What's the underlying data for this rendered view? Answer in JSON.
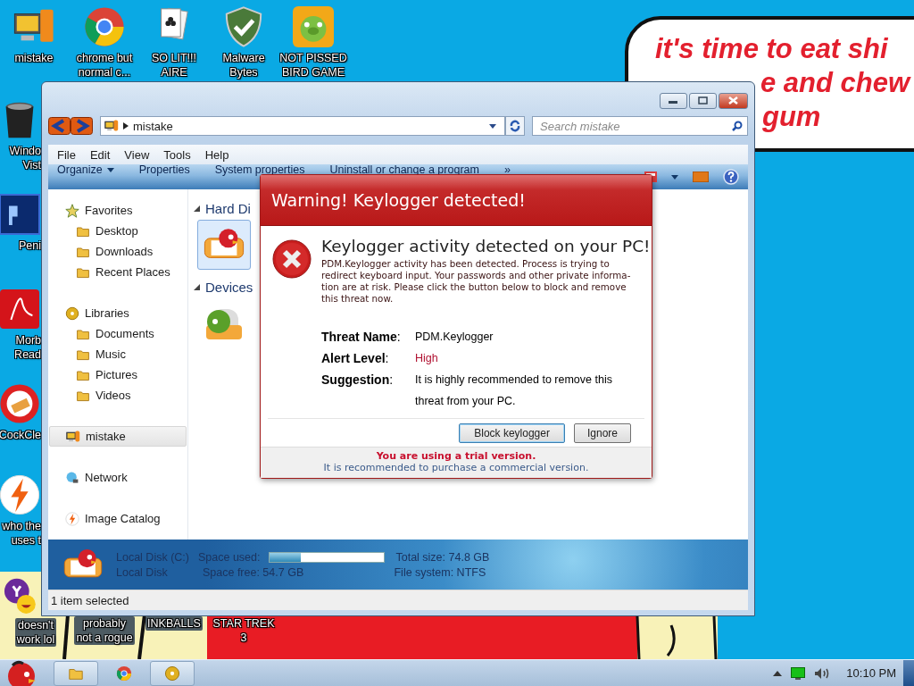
{
  "wallpaper": {
    "speech_bubble": [
      "it's time to eat shi",
      "e and chew",
      "gum"
    ]
  },
  "desktop_icons": [
    {
      "kind": "computer",
      "lines": [
        "mistake"
      ]
    },
    {
      "kind": "browser",
      "lines": [
        "chrome but",
        "normal c..."
      ]
    },
    {
      "kind": "cards",
      "lines": [
        "SO LIT!!!",
        "AIRE"
      ]
    },
    {
      "kind": "shield",
      "lines": [
        "Malware",
        "Bytes"
      ]
    },
    {
      "kind": "pig",
      "lines": [
        "NOT PISSED",
        "BIRD GAME"
      ]
    },
    {
      "kind": "bin",
      "lines": [
        "Windo",
        "Vist"
      ]
    },
    {
      "kind": "ps",
      "lines": [
        "Peni"
      ]
    },
    {
      "kind": "pdf",
      "lines": [
        "Morb",
        "Read"
      ]
    },
    {
      "kind": "cleaner",
      "lines": [
        "CockCle"
      ]
    },
    {
      "kind": "bolt",
      "lines": [
        "who the",
        "uses t"
      ]
    },
    {
      "kind": "yahoo",
      "lines": [
        "doesn't",
        "work lol"
      ]
    },
    {
      "kind": "hidden",
      "lines": [
        "probably",
        "not a rogue"
      ]
    },
    {
      "kind": "hidden",
      "lines": [
        "INKBALLS"
      ]
    },
    {
      "kind": "hidden",
      "lines": [
        "STAR TREK",
        "3"
      ]
    }
  ],
  "explorer": {
    "address": "mistake",
    "search": {
      "placeholder": "Search mistake"
    },
    "menu": [
      "File",
      "Edit",
      "View",
      "Tools",
      "Help"
    ],
    "commands": [
      {
        "label": "Organize",
        "dropdown": true
      },
      {
        "label": "Properties",
        "dropdown": false
      },
      {
        "label": "System properties",
        "dropdown": false
      },
      {
        "label": "Uninstall or change a program",
        "dropdown": false
      },
      {
        "label": "»",
        "dropdown": false
      }
    ],
    "nav": [
      {
        "label": "Favorites",
        "kind": "star",
        "selected": false,
        "children": [
          {
            "label": "Desktop",
            "kind": "folder",
            "selected": false
          },
          {
            "label": "Downloads",
            "kind": "folder",
            "selected": false
          },
          {
            "label": "Recent Places",
            "kind": "folder",
            "selected": false
          }
        ]
      },
      {
        "label": "Libraries",
        "kind": "disc",
        "selected": false,
        "children": [
          {
            "label": "Documents",
            "kind": "folder",
            "selected": false
          },
          {
            "label": "Music",
            "kind": "folder",
            "selected": false
          },
          {
            "label": "Pictures",
            "kind": "folder",
            "selected": false
          },
          {
            "label": "Videos",
            "kind": "folder",
            "selected": false
          }
        ]
      },
      {
        "label": "mistake",
        "kind": "computer",
        "selected": true
      },
      {
        "label": "Network",
        "kind": "network",
        "selected": false
      },
      {
        "label": "Image Catalog",
        "kind": "bolt",
        "selected": false
      }
    ],
    "sections": [
      {
        "title": "Hard Di",
        "item_selected": true
      },
      {
        "title": "Devices",
        "item_selected": false
      }
    ],
    "details": {
      "name": "Local Disk (C:)",
      "type": "Local Disk",
      "used_label": "Space used:",
      "level": 0.27,
      "free": "Space free: 54.7 GB",
      "total": "Total size: 74.8 GB",
      "filesystem": "File system: NTFS"
    },
    "status": "1 item selected"
  },
  "dialog": {
    "title": "Warning! Keylogger detected!",
    "heading": "Keylogger activity detected on your PC!",
    "message": "PDM.Keylogger activity has been detected. Process is trying to redirect keyboard input. Your passwords and other private informa-tion are at risk. Please click the button below to block and remove this threat now.",
    "rows": [
      {
        "label": "**Threat Name**:",
        "value": "PDM.Keylogger",
        "color": "#000000"
      },
      {
        "label": "**Alert Level**:",
        "value": "High",
        "color": "#b01030"
      },
      {
        "label": "**Suggestion**:",
        "value": "It is highly recommended to remove this threat from your PC.",
        "color": "#000000"
      }
    ],
    "buttons": [
      {
        "label": "Block keylogger",
        "default": true
      },
      {
        "label": "Ignore",
        "default": false
      }
    ],
    "trial": "You are using a trial version.",
    "recommend": "It is recommended to purchase a commercial version."
  },
  "taskbar": {
    "buttons": [
      {
        "kind": "folder",
        "running": true
      },
      {
        "kind": "browser",
        "running": false
      },
      {
        "kind": "disc",
        "running": true
      }
    ],
    "clock": "10:10 PM"
  }
}
